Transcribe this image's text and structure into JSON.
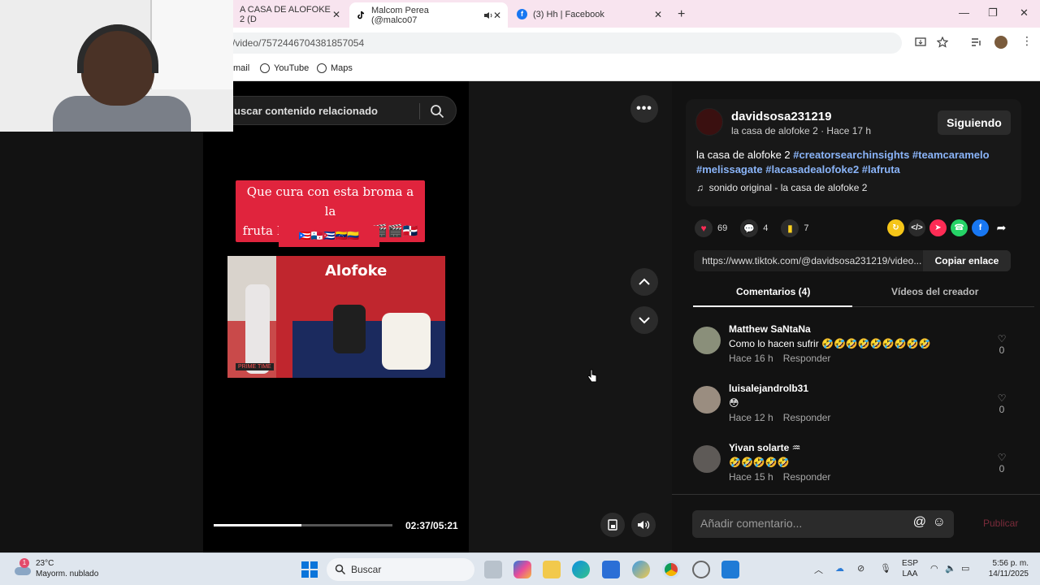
{
  "browser": {
    "tabs": [
      {
        "label": "A CASA DE ALOFOKE 2 (D",
        "close": "✕"
      },
      {
        "label": "Malcom Perea (@malco07",
        "close": "✕",
        "active": true
      },
      {
        "label": "(3) Hh | Facebook",
        "close": "✕"
      }
    ],
    "new_tab": "+",
    "url": "/video/7572446704381857054",
    "bookmarks": [
      "mail",
      "YouTube",
      "Maps"
    ]
  },
  "left_panel": {
    "search_placeholder": "uscar contenido relacionado"
  },
  "video": {
    "caption_line1": "Que cura con esta broma a la",
    "caption_line2": "fruta Roland cuchillo🎬🎬🇩🇴",
    "caption_flags": "🇵🇷🇵🇦🇨🇺🇻🇪🇨🇴",
    "logo_text": "Alofoke",
    "tag_text": "PRIME TIME",
    "time": "02:37/05:21",
    "progress": 0.49
  },
  "creator": {
    "username": "davidsosa231219",
    "meta": "la casa de alofoke 2 · Hace 17 h",
    "follow_label": "Siguiendo",
    "description_text": "la casa de alofoke 2 ",
    "hashtags": "#creatorsearchinsights #teamcaramelo #melissagate #lacasadealofoke2 #lafruta",
    "sound": "sonido original - la casa de alofoke 2"
  },
  "actions": {
    "likes": "69",
    "comments": "4",
    "saves": "7"
  },
  "share": {
    "link": "https://www.tiktok.com/@davidsosa231219/video...",
    "copy_label": "Copiar enlace"
  },
  "tabs": {
    "comments": "Comentarios (4)",
    "creator_videos": "Vídeos del creador"
  },
  "comments": [
    {
      "name": "Matthew SaNtaNa",
      "text": "Como lo hacen sufrir 🤣🤣🤣🤣🤣🤣🤣🤣🤣",
      "time": "Hace 16 h",
      "reply": "Responder",
      "likes": "0"
    },
    {
      "name": "luisalejandrolb31",
      "text": "😳",
      "time": "Hace 12 h",
      "reply": "Responder",
      "likes": "0"
    },
    {
      "name": "Yivan solarte ♒",
      "text": "🤣🤣🤣🤣🤣",
      "time": "Hace 15 h",
      "reply": "Responder",
      "likes": "0"
    }
  ],
  "comment_box": {
    "placeholder": "Añadir comentario...",
    "publish": "Publicar"
  },
  "taskbar": {
    "temp": "23°C",
    "weather": "Mayorm. nublado",
    "badge": "1",
    "search": "Buscar",
    "lang1": "ESP",
    "lang2": "LAA",
    "time": "5:56 p. m.",
    "date": "14/11/2025"
  }
}
